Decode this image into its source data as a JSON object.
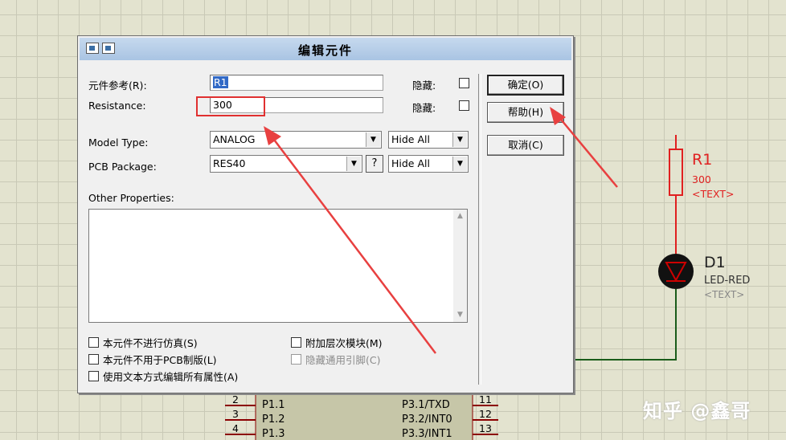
{
  "dialog": {
    "title": "编辑元件",
    "fields": {
      "ref_label": "元件参考(R):",
      "ref_value": "R1",
      "ref_hidden_label": "隐藏:",
      "resistance_label": "Resistance:",
      "resistance_value": "300",
      "resistance_hidden_label": "隐藏:",
      "model_type_label": "Model Type:",
      "model_type_value": "ANALOG",
      "model_type_hide": "Hide All",
      "pcb_label": "PCB Package:",
      "pcb_value": "RES40",
      "pcb_help": "?",
      "pcb_hide": "Hide All",
      "other_props_label": "Other Properties:"
    },
    "buttons": {
      "ok": "确定(O)",
      "help": "帮助(H)",
      "cancel": "取消(C)"
    },
    "checkboxes": {
      "no_sim": "本元件不进行仿真(S)",
      "no_pcb": "本元件不用于PCB制版(L)",
      "text_edit": "使用文本方式编辑所有属性(A)",
      "attach_hier": "附加层次模块(M)",
      "hide_pins": "隐藏通用引脚(C)"
    }
  },
  "schematic": {
    "r1": {
      "ref": "R1",
      "value": "300",
      "text": "<TEXT>"
    },
    "d1": {
      "ref": "D1",
      "value": "LED-RED",
      "text": "<TEXT>"
    },
    "chip": {
      "left_pins": [
        {
          "num": "2",
          "name": "P1.1"
        },
        {
          "num": "3",
          "name": "P1.2"
        },
        {
          "num": "4",
          "name": "P1.3"
        }
      ],
      "right_pins": [
        {
          "num": "11",
          "name": "P3.1/TXD"
        },
        {
          "num": "12",
          "name": "P3.2/INT0"
        },
        {
          "num": "13",
          "name": "P3.3/INT1"
        }
      ]
    },
    "colors": {
      "resistor": "#e02020",
      "wire": "#1a5c1a",
      "led": "#8b0000",
      "pin": "#8b0000"
    }
  },
  "watermark": "知乎 @鑫哥"
}
